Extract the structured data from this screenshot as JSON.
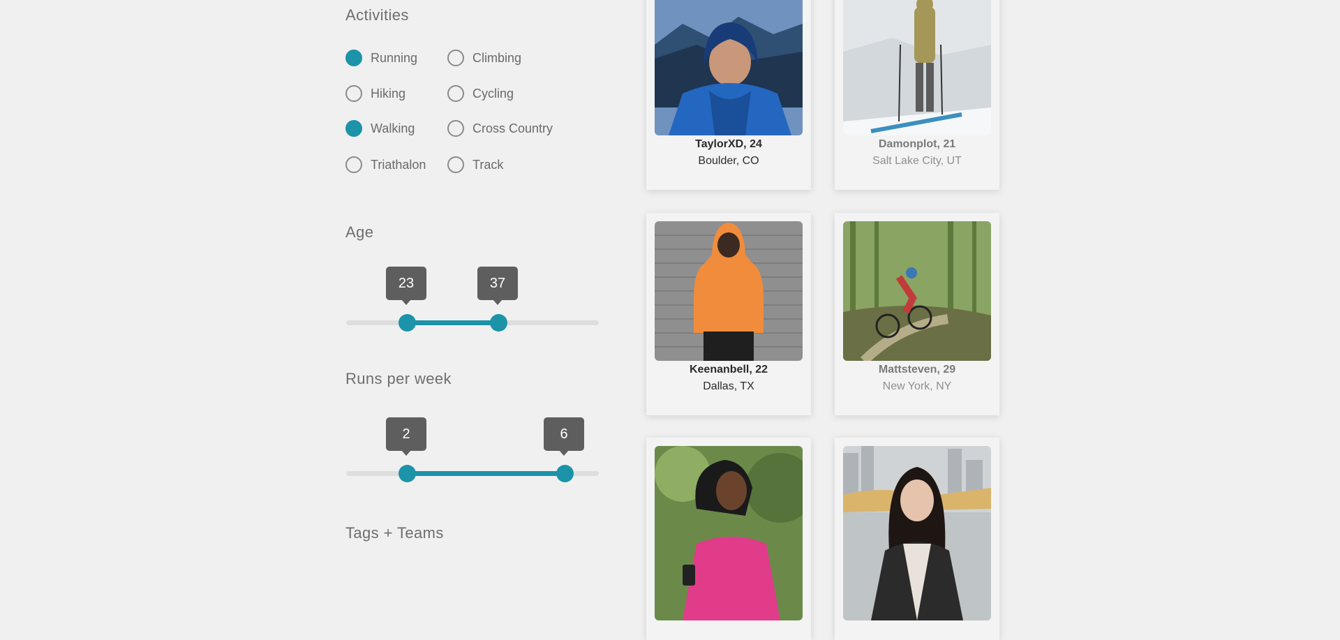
{
  "filters": {
    "activities_title": "Activities",
    "activities": [
      {
        "label": "Running",
        "checked": true
      },
      {
        "label": "Climbing",
        "checked": false
      },
      {
        "label": "Hiking",
        "checked": false
      },
      {
        "label": "Cycling",
        "checked": false
      },
      {
        "label": "Walking",
        "checked": true
      },
      {
        "label": "Cross Country",
        "checked": false
      },
      {
        "label": "Triathalon",
        "checked": false
      },
      {
        "label": "Track",
        "checked": false
      }
    ],
    "age": {
      "title": "Age",
      "low": "23",
      "high": "37"
    },
    "runs": {
      "title": "Runs per week",
      "low": "2",
      "high": "6"
    },
    "tags_title": "Tags + Teams"
  },
  "profiles": [
    {
      "name": "TaylorXD, 24",
      "location": "Boulder, CO"
    },
    {
      "name": "Damonplot, 21",
      "location": "Salt Lake City, UT"
    },
    {
      "name": "Keenanbell, 22",
      "location": "Dallas, TX"
    },
    {
      "name": "Mattsteven, 29",
      "location": "New York, NY"
    },
    {
      "name": "",
      "location": ""
    },
    {
      "name": "",
      "location": ""
    }
  ],
  "colors": {
    "accent": "#1c93a8",
    "tooltip": "#5e5e5e",
    "background": "#f0f0f0"
  }
}
